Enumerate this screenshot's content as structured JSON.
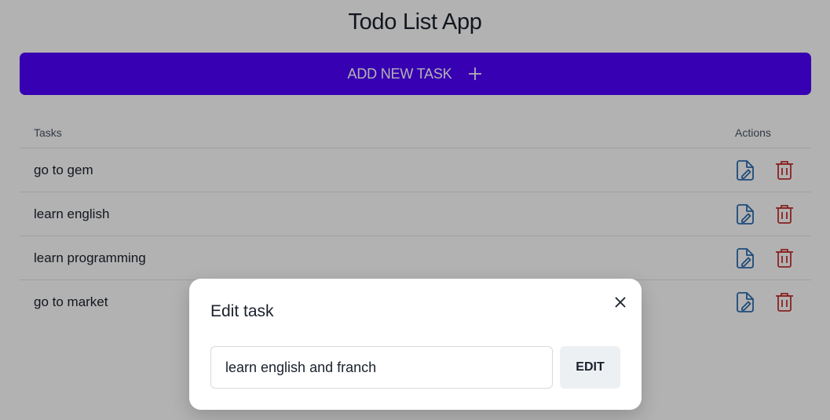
{
  "app": {
    "title": "Todo List App"
  },
  "toolbar": {
    "add_label": "ADD NEW TASK",
    "add_icon": "plus-icon"
  },
  "table": {
    "headers": {
      "tasks": "Tasks",
      "actions": "Actions"
    },
    "rows": [
      {
        "task": "go to gem"
      },
      {
        "task": "learn english"
      },
      {
        "task": "learn programming"
      },
      {
        "task": "go to market"
      }
    ],
    "edit_icon": "file-edit-icon",
    "delete_icon": "trash-icon"
  },
  "modal": {
    "title": "Edit task",
    "input_value": "learn english and franch",
    "edit_label": "EDIT",
    "close_icon": "close-icon"
  },
  "colors": {
    "accent": "#5000ff",
    "edit_icon": "#2b6cb0",
    "delete_icon": "#c53030",
    "overlay": "rgba(0,0,0,0.30)"
  }
}
